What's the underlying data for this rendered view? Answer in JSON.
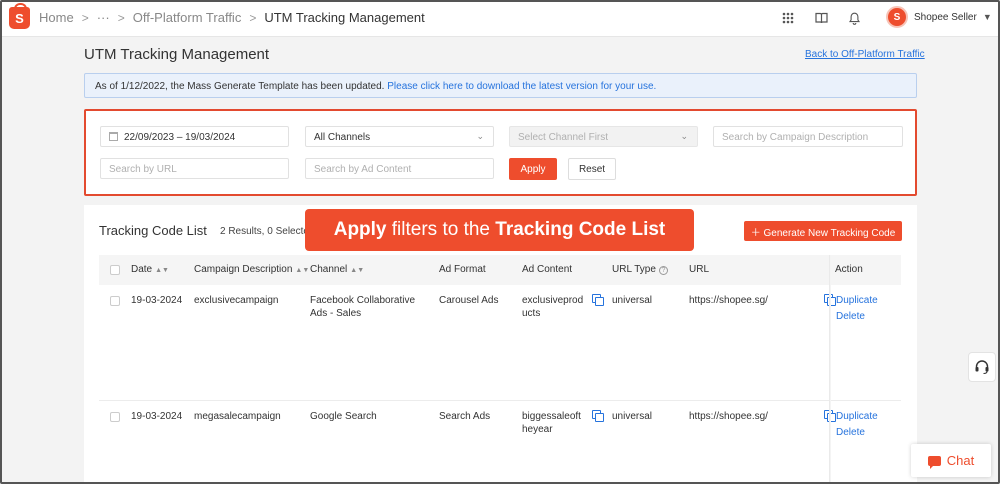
{
  "topbar": {
    "logo": "S",
    "breadcrumbs": [
      "Home",
      "···",
      "Off-Platform Traffic",
      "UTM Tracking Management"
    ],
    "seller_name": "Shopee Seller",
    "icons": [
      "apps-grid-icon",
      "book-icon",
      "bell-icon"
    ]
  },
  "page": {
    "title": "UTM Tracking Management",
    "back_link": "Back to Off-Platform Traffic"
  },
  "banner": {
    "text": "As of 1/12/2022, the Mass Generate Template has been updated. ",
    "link": "Please click here to download the latest version for your use."
  },
  "filters": {
    "date_range": "22/09/2023 – 19/03/2024",
    "channel": "All Channels",
    "channel_detail_placeholder": "Select Channel First",
    "campaign_placeholder": "Search by Campaign Description",
    "url_placeholder": "Search by URL",
    "ad_content_placeholder": "Search by Ad Content",
    "apply_label": "Apply",
    "reset_label": "Reset"
  },
  "list": {
    "title": "Tracking Code List",
    "count": "2 Results, 0 Selected",
    "generate_label": "Generate New Tracking Code",
    "columns": [
      "Date",
      "Campaign Description",
      "Channel",
      "Ad Format",
      "Ad Content",
      "URL Type",
      "URL",
      "Action"
    ],
    "rows": [
      {
        "date": "19-03-2024",
        "campaign": "exclusivecampaign",
        "channel": "Facebook Collaborative Ads - Sales",
        "ad_format": "Carousel Ads",
        "ad_content": "exclusiveproducts",
        "url_type": "universal",
        "url": "https://shopee.sg/",
        "action_duplicate": "Duplicate",
        "action_delete": "Delete"
      },
      {
        "date": "19-03-2024",
        "campaign": "megasalecampaign",
        "channel": "Google Search",
        "ad_format": "Search Ads",
        "ad_content": "biggessaleoftheyear",
        "url_type": "universal",
        "url": "https://shopee.sg/",
        "action_duplicate": "Duplicate",
        "action_delete": "Delete"
      }
    ]
  },
  "tooltip": {
    "part1": "Apply",
    "part2": " filters to the ",
    "part3": "Tracking Code List"
  },
  "chat": {
    "label": "Chat"
  },
  "colors": {
    "brand": "#ee4d2d",
    "link": "#2673dd",
    "banner_bg": "#eaf1fb"
  }
}
